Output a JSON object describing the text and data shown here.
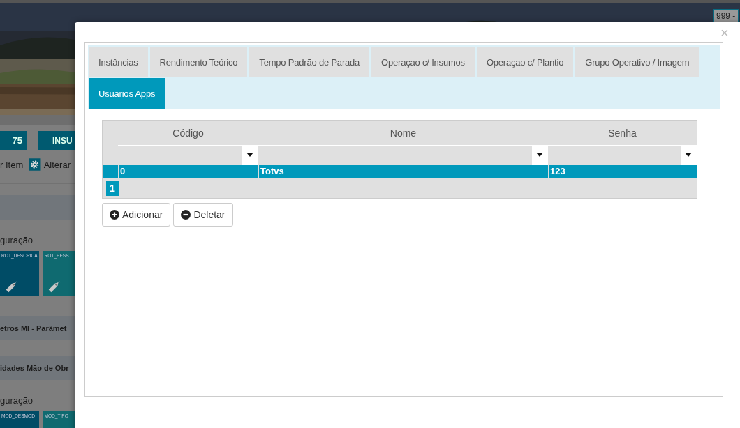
{
  "background_page": {
    "corner_field": "999 -",
    "buttons": [
      "75",
      "INSU"
    ],
    "actions": [
      "r Item",
      "Alterar"
    ],
    "sections": [
      {
        "kind": "band"
      },
      {
        "kind": "label",
        "text": "guração"
      },
      {
        "kind": "tiles",
        "tiles": [
          {
            "label": "ROT_DESCRICA",
            "color": "#004c66",
            "tag_icon": true
          },
          {
            "label": "ROT_PESS",
            "color": "#0f6a70",
            "tag_icon": true
          }
        ]
      },
      {
        "kind": "band",
        "text": "etros MI - Parâmet"
      },
      {
        "kind": "band",
        "text": "idades Mão de Obr"
      },
      {
        "kind": "label",
        "text": "guração"
      },
      {
        "kind": "tiles",
        "tiles": [
          {
            "label": "MOD_DESMOD",
            "color": "#004c66"
          },
          {
            "label": "MOD_TIPO",
            "color": "#0f6a70"
          }
        ]
      }
    ]
  },
  "dialog": {
    "close": "×",
    "tabs": [
      {
        "label": "Instâncias",
        "selected": false
      },
      {
        "label": "Rendimento Teórico",
        "selected": false
      },
      {
        "label": "Tempo Padrão de Parada",
        "selected": false
      },
      {
        "label": "Operaçao c/ Insumos",
        "selected": false
      },
      {
        "label": "Operaçao c/ Plantio",
        "selected": false
      },
      {
        "label": "Grupo Operativo / Imagem",
        "selected": false
      },
      {
        "label": "Usuarios Apps",
        "selected": true
      }
    ],
    "grid": {
      "columns": [
        "Código",
        "Nome",
        "Senha"
      ],
      "rows": [
        {
          "cells": [
            "0",
            "Totvs",
            "123"
          ],
          "selected": true
        }
      ],
      "pages": [
        {
          "label": "1",
          "selected": true
        }
      ]
    },
    "buttons": [
      {
        "label": "Adicionar",
        "kind": "add"
      },
      {
        "label": "Deletar",
        "kind": "delete"
      }
    ]
  }
}
